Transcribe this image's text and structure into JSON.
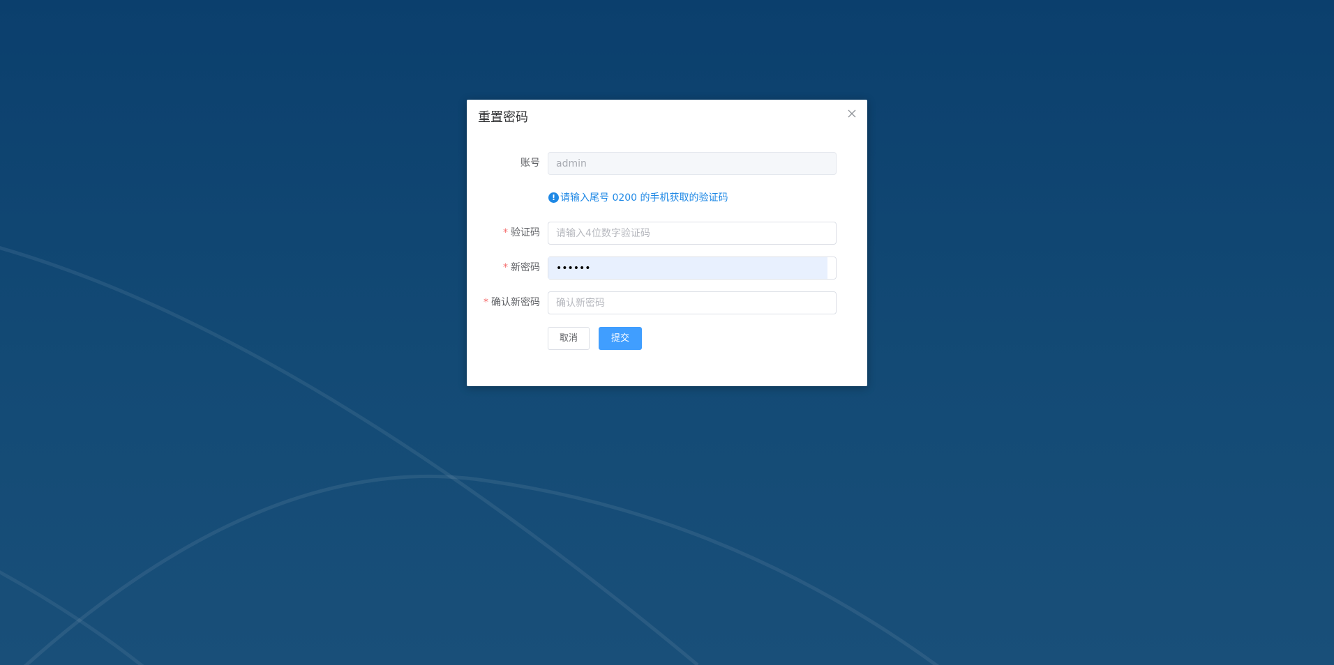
{
  "dialog": {
    "title": "重置密码",
    "close_icon": "close-icon"
  },
  "form": {
    "account": {
      "label": "账号",
      "value": "admin",
      "disabled": true
    },
    "hint": {
      "icon": "info-icon",
      "icon_glyph": "!",
      "text": "请输入尾号 0200 的手机获取的验证码"
    },
    "code": {
      "label": "验证码",
      "required_mark": "*",
      "placeholder": "请输入4位数字验证码",
      "value": ""
    },
    "new_password": {
      "label": "新密码",
      "required_mark": "*",
      "value": "••••••"
    },
    "confirm_password": {
      "label": "确认新密码",
      "required_mark": "*",
      "placeholder": "确认新密码",
      "value": ""
    }
  },
  "buttons": {
    "cancel": "取消",
    "submit": "提交"
  },
  "colors": {
    "primary": "#409eff",
    "hint": "#1e88e5",
    "required": "#f56c6c",
    "background": "#0b3f6d"
  }
}
